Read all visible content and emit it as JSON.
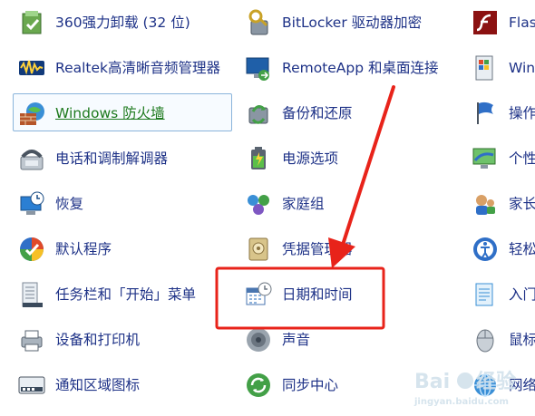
{
  "columns": [
    [
      {
        "label": "360强力卸载 (32 位)",
        "icon": "uninstall-box-icon"
      },
      {
        "label": "Realtek高清晰音频管理器",
        "icon": "audio-waveform-icon"
      },
      {
        "label": "Windows 防火墙",
        "icon": "firewall-globe-icon",
        "selected": true
      },
      {
        "label": "电话和调制解调器",
        "icon": "telephone-icon"
      },
      {
        "label": "恢复",
        "icon": "recovery-computer-icon"
      },
      {
        "label": "默认程序",
        "icon": "default-programs-icon"
      },
      {
        "label": "任务栏和「开始」菜单",
        "icon": "taskbar-icon"
      },
      {
        "label": "设备和打印机",
        "icon": "printer-icon"
      },
      {
        "label": "通知区域图标",
        "icon": "notification-area-icon"
      }
    ],
    [
      {
        "label": "BitLocker 驱动器加密",
        "icon": "bitlocker-key-icon"
      },
      {
        "label": "RemoteApp 和桌面连接",
        "icon": "remoteapp-monitor-icon"
      },
      {
        "label": "备份和还原",
        "icon": "backup-restore-icon"
      },
      {
        "label": "电源选项",
        "icon": "power-battery-icon"
      },
      {
        "label": "家庭组",
        "icon": "homegroup-icon"
      },
      {
        "label": "凭据管理器",
        "icon": "credential-vault-icon"
      },
      {
        "label": "日期和时间",
        "icon": "calendar-clock-icon"
      },
      {
        "label": "声音",
        "icon": "speaker-icon"
      },
      {
        "label": "同步中心",
        "icon": "sync-center-icon"
      }
    ],
    [
      {
        "label": "Flas",
        "icon": "flash-player-icon"
      },
      {
        "label": "Win",
        "icon": "windows-update-icon"
      },
      {
        "label": "操作",
        "icon": "action-center-flag-icon"
      },
      {
        "label": "个性",
        "icon": "personalization-icon"
      },
      {
        "label": "家长",
        "icon": "parental-controls-icon"
      },
      {
        "label": "轻松",
        "icon": "ease-of-access-icon"
      },
      {
        "label": "入门",
        "icon": "getting-started-icon"
      },
      {
        "label": "鼠标",
        "icon": "mouse-icon"
      },
      {
        "label": "网络",
        "icon": "network-icon"
      }
    ]
  ],
  "watermark": {
    "text": "Baidu",
    "sub": "jingyan.baidu.com"
  },
  "colors": {
    "link": "#1e3287",
    "selected_link": "#1e7a1e",
    "annotation": "#e8231a"
  }
}
